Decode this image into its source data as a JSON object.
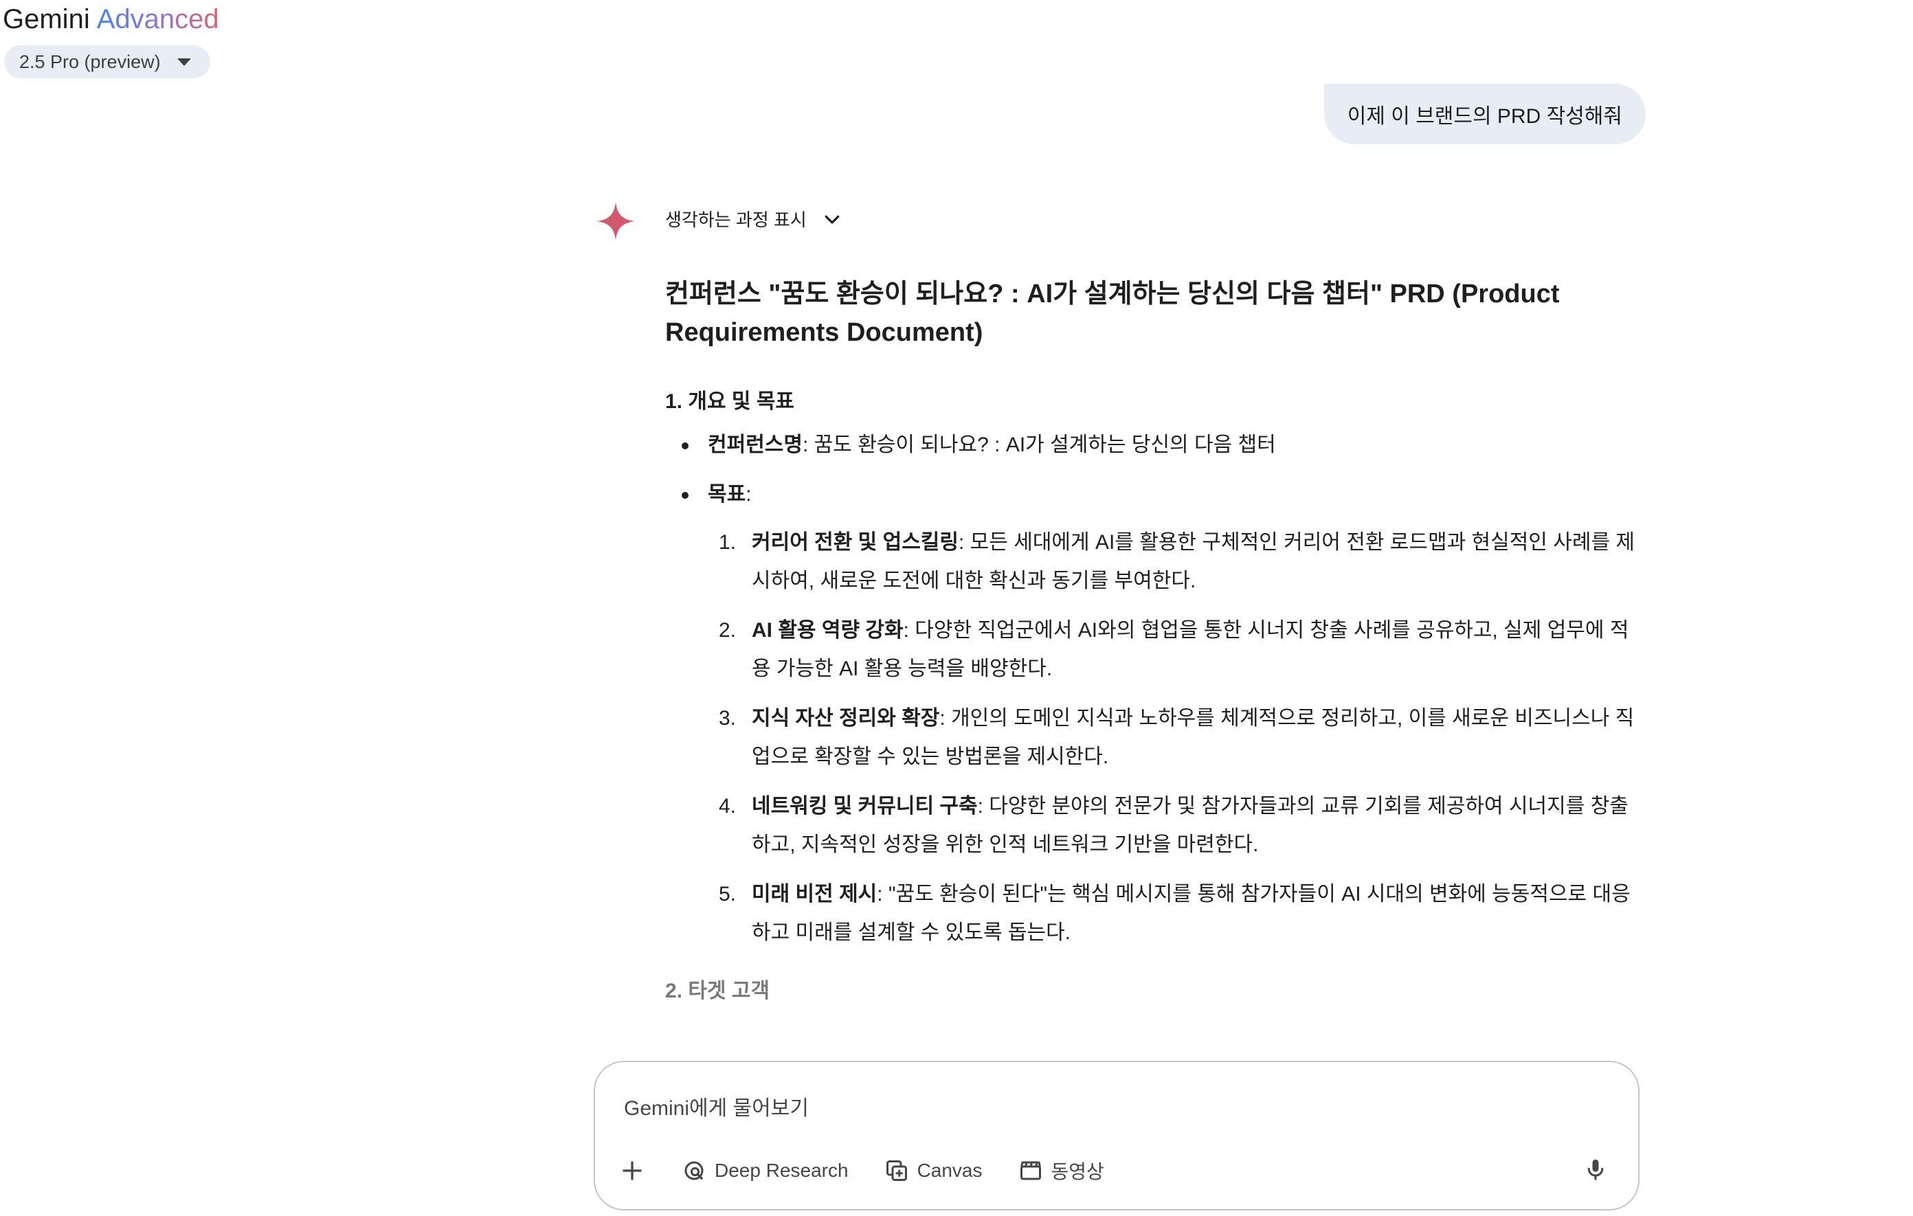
{
  "header": {
    "app_name": "Gemini",
    "tier": "Advanced",
    "model_label": "2.5 Pro (preview)"
  },
  "chat": {
    "user_message": "이제 이 브랜드의 PRD 작성해줘",
    "thinking_label": "생각하는 과정 표시",
    "response": {
      "title": "컨퍼런스 \"꿈도 환승이 되나요? : AI가 설계하는 당신의 다음 챕터\" PRD (Product Requirements Document)",
      "section1_heading": "1. 개요 및 목표",
      "conference_name_label": "컨퍼런스명",
      "conference_name_value": ": 꿈도 환승이 되나요? : AI가 설계하는 당신의 다음 챕터",
      "goals_label": "목표",
      "goals_colon": ":",
      "goals": [
        {
          "num": "1.",
          "title": "커리어 전환 및 업스킬링",
          "text": ": 모든 세대에게 AI를 활용한 구체적인 커리어 전환 로드맵과 현실적인 사례를 제시하여, 새로운 도전에 대한 확신과 동기를 부여한다."
        },
        {
          "num": "2.",
          "title": "AI 활용 역량 강화",
          "text": ": 다양한 직업군에서 AI와의 협업을 통한 시너지 창출 사례를 공유하고, 실제 업무에 적용 가능한 AI 활용 능력을 배양한다."
        },
        {
          "num": "3.",
          "title": "지식 자산 정리와 확장",
          "text": ": 개인의 도메인 지식과 노하우를 체계적으로 정리하고, 이를 새로운 비즈니스나 직업으로 확장할 수 있는 방법론을 제시한다."
        },
        {
          "num": "4.",
          "title": "네트워킹 및 커뮤니티 구축",
          "text": ": 다양한 분야의 전문가 및 참가자들과의 교류 기회를 제공하여 시너지를 창출하고, 지속적인 성장을 위한 인적 네트워크 기반을 마련한다."
        },
        {
          "num": "5.",
          "title": "미래 비전 제시",
          "text": ": \"꿈도 환승이 된다\"는 핵심 메시지를 통해 참가자들이 AI 시대의 변화에 능동적으로 대응하고 미래를 설계할 수 있도록 돕는다."
        }
      ],
      "section2_heading": "2. 타겟 고객"
    }
  },
  "input": {
    "placeholder": "Gemini에게 물어보기",
    "tools": {
      "deep_research": "Deep Research",
      "canvas": "Canvas",
      "video": "동영상"
    }
  },
  "colors": {
    "star": "#d05a6c",
    "bubble": "#e8edf5"
  }
}
